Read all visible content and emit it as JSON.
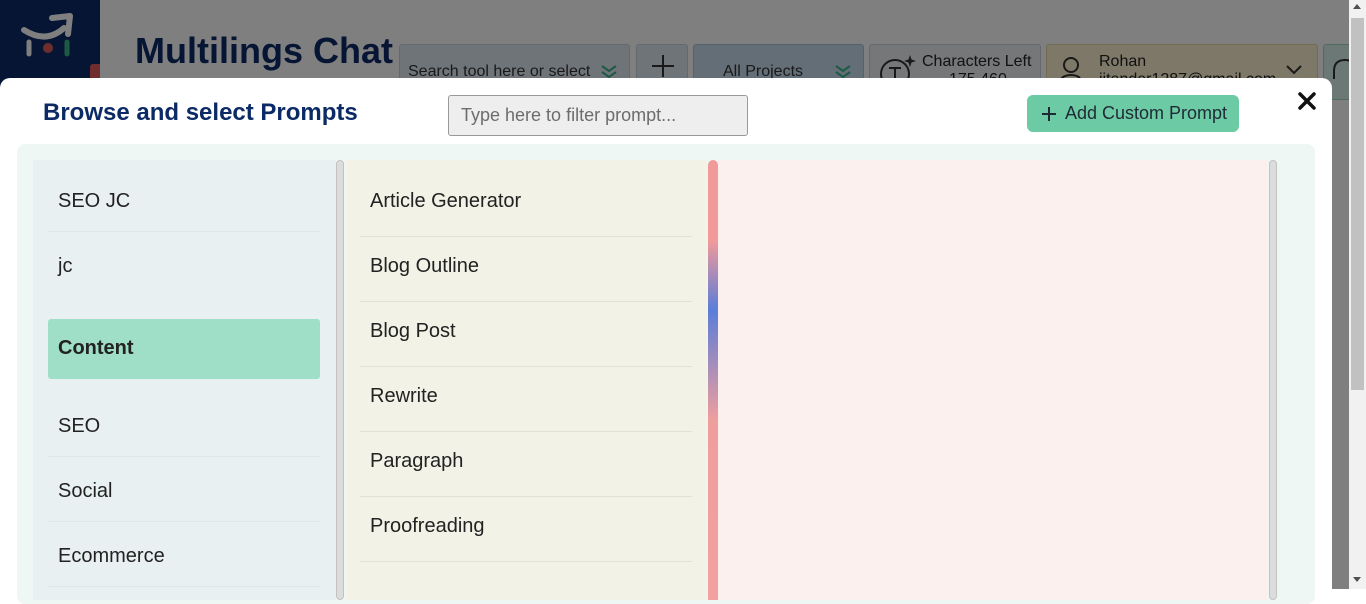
{
  "app": {
    "title": "Multilings Chat",
    "tool_search_placeholder": "Search tool here or select",
    "projects_label": "All Projects",
    "characters_label": "Characters Left",
    "characters_value": "175,460",
    "user_name": "Rohan",
    "user_email": "jitender1287@gmail.com"
  },
  "modal": {
    "title": "Browse and select Prompts",
    "filter_placeholder": "Type here to filter prompt...",
    "add_button_label": "Add Custom Prompt",
    "categories": [
      "SEO JC",
      "jc",
      "Content",
      "SEO",
      "Social",
      "Ecommerce"
    ],
    "active_category": "Content",
    "prompts": [
      "Article Generator",
      "Blog Outline",
      "Blog Post",
      "Rewrite",
      "Paragraph",
      "Proofreading"
    ]
  },
  "colors": {
    "brand_navy": "#0c2a66",
    "accent_green": "#6ccaa5",
    "active_category_bg": "#9fdec7"
  }
}
